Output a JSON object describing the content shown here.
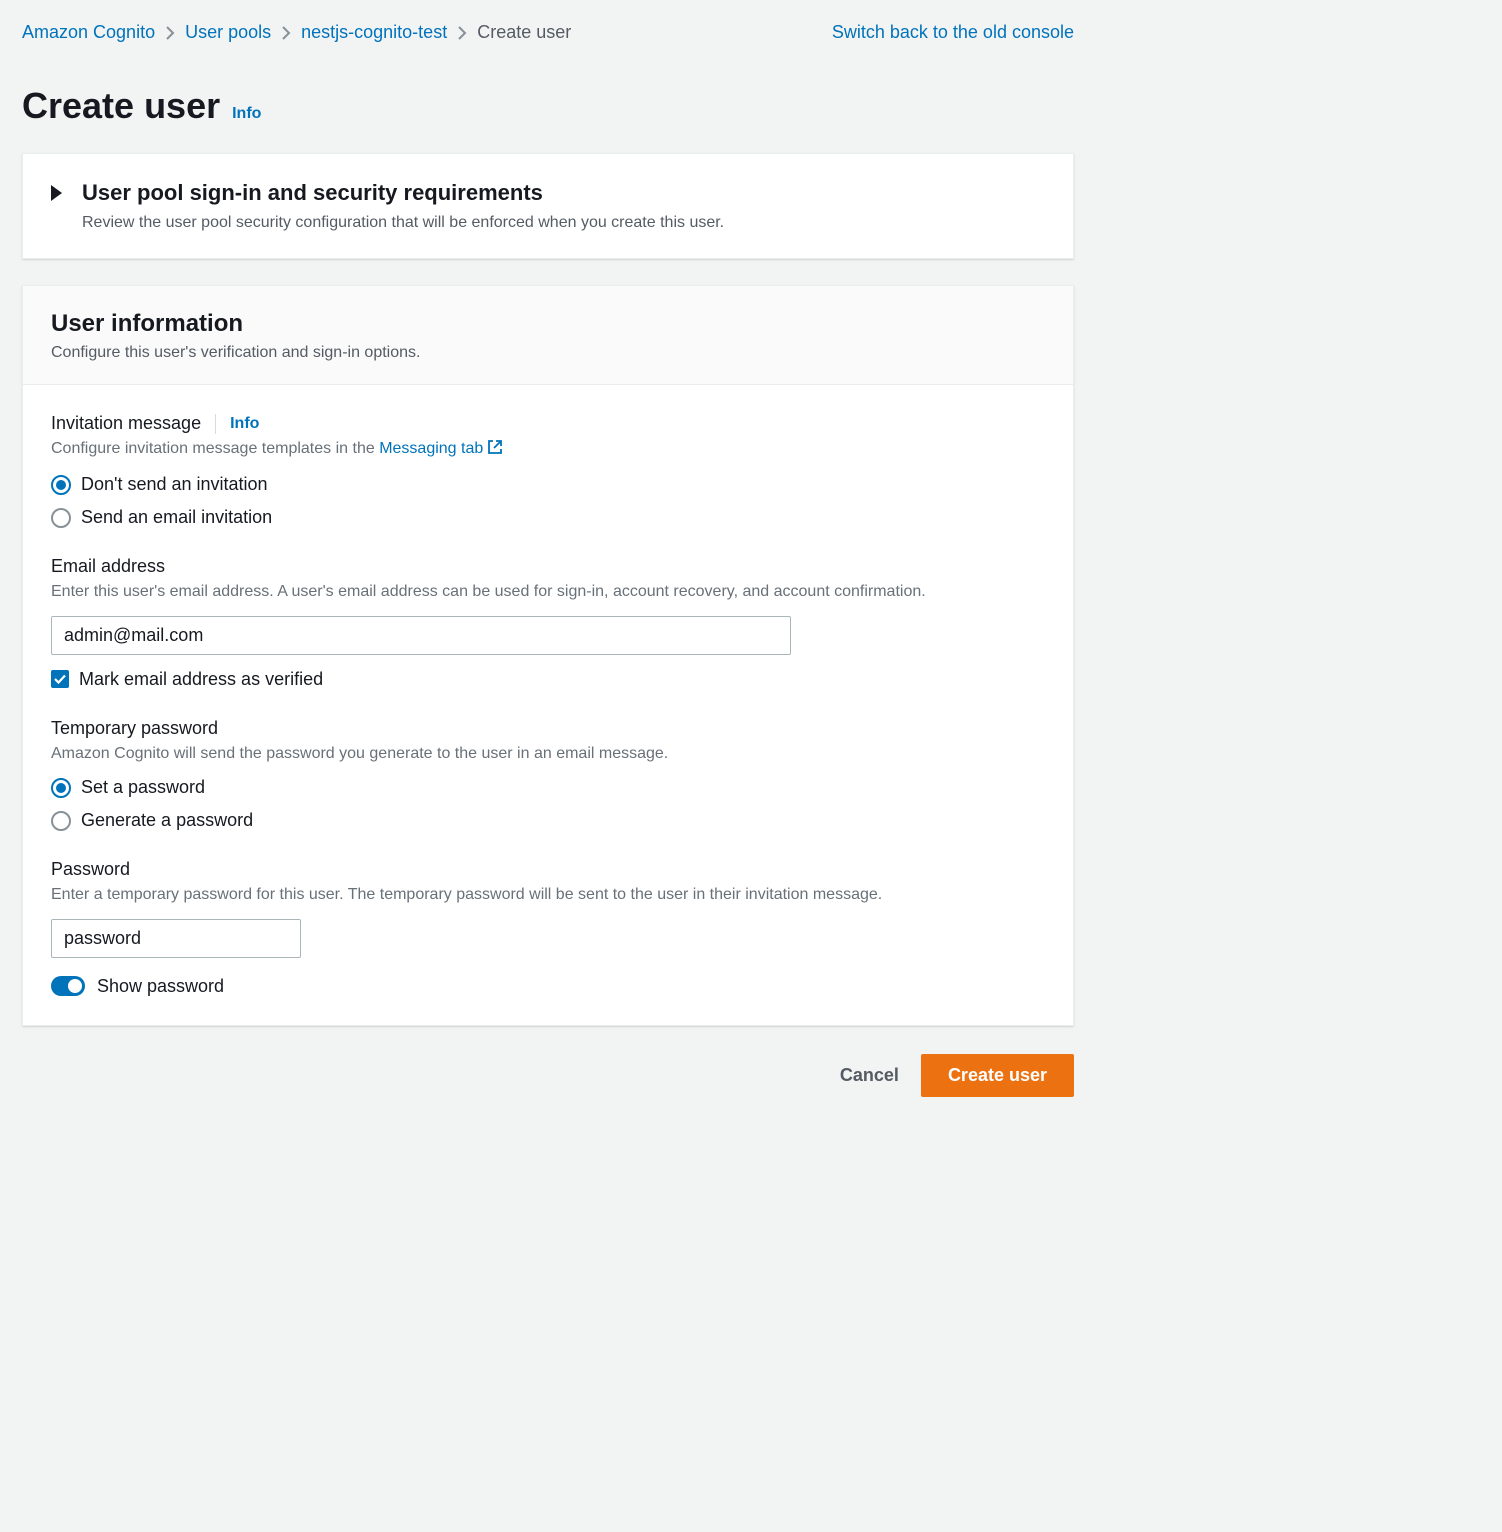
{
  "breadcrumbs": {
    "items": [
      {
        "label": "Amazon Cognito"
      },
      {
        "label": "User pools"
      },
      {
        "label": "nestjs-cognito-test"
      }
    ],
    "current": "Create user"
  },
  "switch_link": "Switch back to the old console",
  "page_title": "Create user",
  "page_title_info": "Info",
  "expand_panel": {
    "title": "User pool sign-in and security requirements",
    "subtitle": "Review the user pool security configuration that will be enforced when you create this user."
  },
  "user_info": {
    "title": "User information",
    "subtitle": "Configure this user's verification and sign-in options."
  },
  "invitation": {
    "label": "Invitation message",
    "info": "Info",
    "desc_prefix": "Configure invitation message templates in the ",
    "desc_link": "Messaging tab",
    "options": [
      {
        "label": "Don't send an invitation",
        "selected": true
      },
      {
        "label": "Send an email invitation",
        "selected": false
      }
    ]
  },
  "email": {
    "label": "Email address",
    "desc": "Enter this user's email address. A user's email address can be used for sign-in, account recovery, and account confirmation.",
    "value": "admin@mail.com",
    "verify_label": "Mark email address as verified",
    "verify_checked": true
  },
  "temp_password": {
    "label": "Temporary password",
    "desc": "Amazon Cognito will send the password you generate to the user in an email message.",
    "options": [
      {
        "label": "Set a password",
        "selected": true
      },
      {
        "label": "Generate a password",
        "selected": false
      }
    ]
  },
  "password": {
    "label": "Password",
    "desc": "Enter a temporary password for this user. The temporary password will be sent to the user in their invitation message.",
    "value": "password",
    "show_label": "Show password",
    "show_on": true
  },
  "footer": {
    "cancel": "Cancel",
    "submit": "Create user"
  }
}
